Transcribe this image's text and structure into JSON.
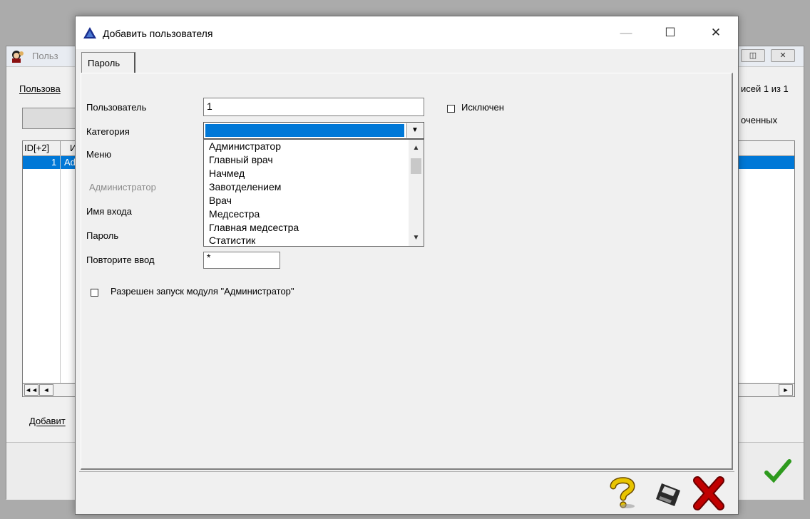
{
  "background_window": {
    "title": "Польз",
    "menu_label": "Пользова",
    "records_label": "исей 1 из 1",
    "filter_label": "оченных",
    "grid_header_id": "ID[+2]",
    "grid_header_col2": "И",
    "grid_row_id": "1",
    "grid_row_val": "Ad",
    "add_button_label": "Добавит",
    "nav_first": "◄◄",
    "nav_prev": "◄",
    "scroll_right": "►",
    "restore_icon": "◫",
    "close_icon": "✕"
  },
  "dialog": {
    "title": "Добавить пользователя",
    "minimize": "—",
    "maximize": "☐",
    "close": "✕",
    "tab_label": "Пароль",
    "form": {
      "user_label": "Пользователь",
      "user_value": "1",
      "category_label": "Категория",
      "menu_label": "Меню",
      "admin_label": "Администратор",
      "login_label": "Имя входа",
      "password_label": "Пароль",
      "repeat_label": "Повторите ввод",
      "repeat_value": "*",
      "excluded_label": "Исключен",
      "allow_admin_label": "Разрешен запуск модуля \"Администратор\""
    },
    "category_options": [
      "Администратор",
      "Главный врач",
      "Начмед",
      "Завотделением",
      "Врач",
      "Медсестра",
      "Главная медсестра",
      "Статистик"
    ],
    "dropdown_arrow": "▼",
    "scroll_up": "▲",
    "scroll_down": "▼"
  },
  "colors": {
    "selection": "#0078d7",
    "help_icon": "#e8c400",
    "cancel_icon": "#c00000",
    "ok_icon": "#2e9a1e"
  }
}
